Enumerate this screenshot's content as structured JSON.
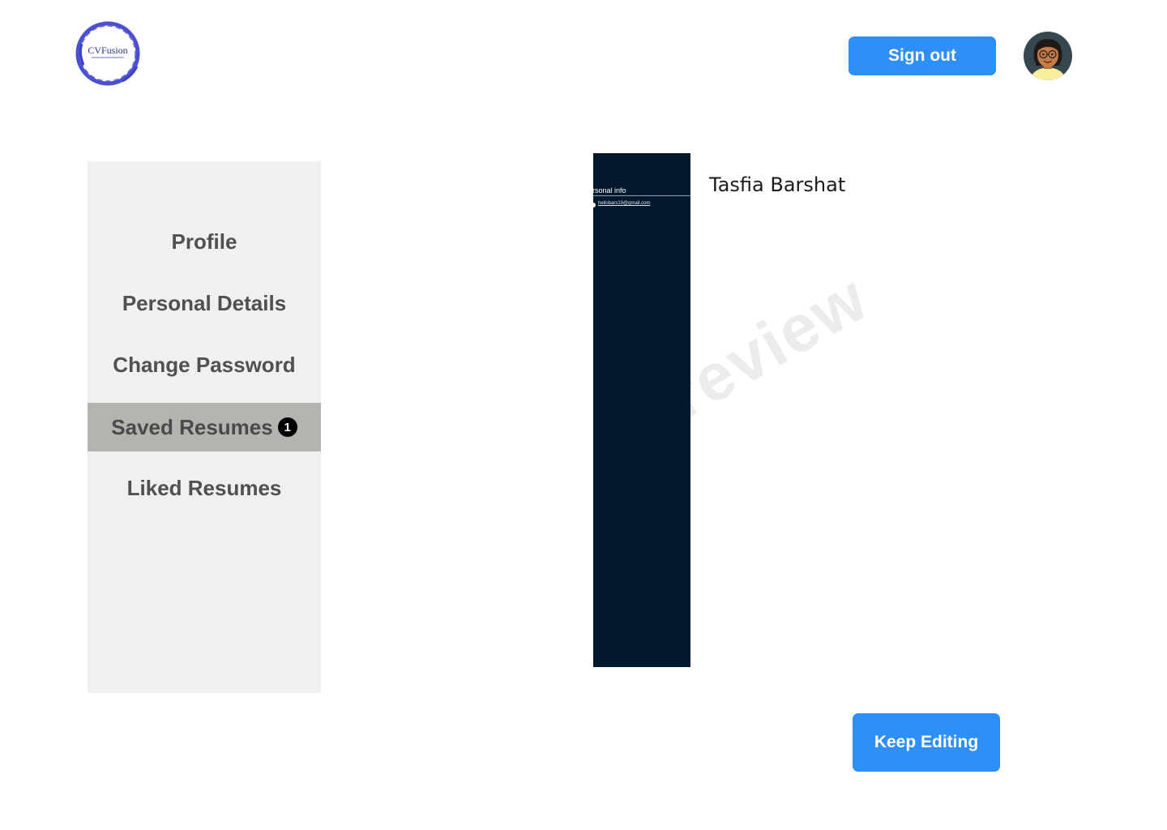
{
  "header": {
    "logo": {
      "text": "CVFusion",
      "icon": "cvfusion-logo",
      "ring_color": "#4b4fd0"
    },
    "sign_out_label": "Sign out",
    "avatar": {
      "icon": "user-avatar-icon"
    }
  },
  "sidebar": {
    "items": [
      {
        "label": "Profile",
        "active": false
      },
      {
        "label": "Personal Details",
        "active": false
      },
      {
        "label": "Change Password",
        "active": false
      },
      {
        "label": "Saved Resumes",
        "active": true,
        "badge": "1"
      },
      {
        "label": "Liked Resumes",
        "active": false
      }
    ]
  },
  "preview": {
    "section_title": "ersonal info",
    "email": "hellobars19@gmail.com",
    "name": "Tasfia Barshat",
    "watermark": "review",
    "strip_color": "#02182c"
  },
  "actions": {
    "keep_editing_label": "Keep Editing"
  },
  "colors": {
    "accent": "#2f8ff8",
    "sidebar_bg": "#f0f0f0",
    "active_item_bg": "#b5b3b0"
  }
}
